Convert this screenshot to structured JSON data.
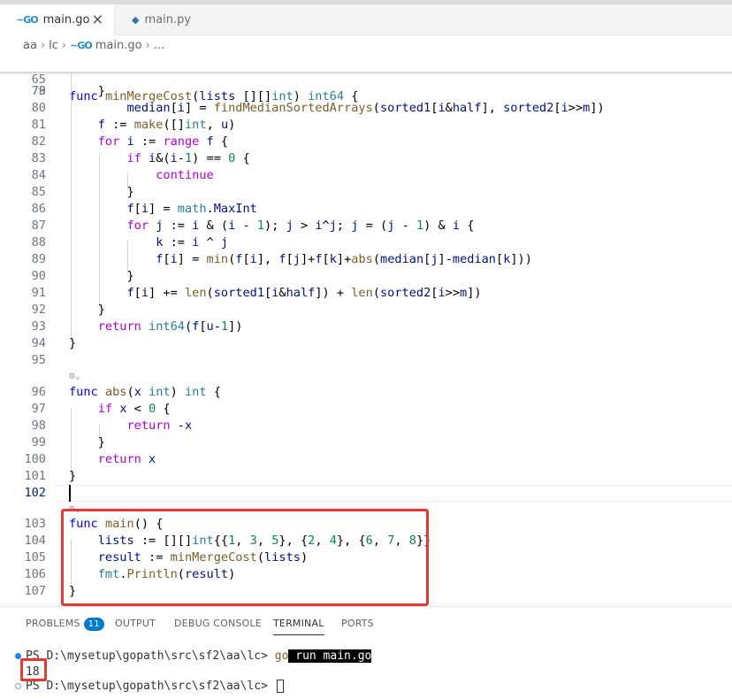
{
  "tabs": [
    {
      "icon": "go-file-icon",
      "label": "main.go",
      "active": true,
      "close": "×"
    },
    {
      "icon": "python-file-icon",
      "label": "main.py",
      "active": false
    }
  ],
  "breadcrumb": [
    "aa",
    "lc",
    "main.go",
    "..."
  ],
  "editor": {
    "sticky_line": {
      "num": "65",
      "text": "func minMergeCost(lists [][]int) int64 {"
    },
    "partial_line": {
      "num": "78",
      "text": "        median[i] = findMedianSortedArrays(sorted1[i&half], sorted2[i>>m])"
    },
    "lines": [
      {
        "num": "79",
        "text": "    }"
      },
      {
        "num": "80",
        "text": ""
      },
      {
        "num": "81",
        "text": "    f := make([]int, u)"
      },
      {
        "num": "82",
        "text": "    for i := range f {"
      },
      {
        "num": "83",
        "text": "        if i&(i-1) == 0 {"
      },
      {
        "num": "84",
        "text": "            continue"
      },
      {
        "num": "85",
        "text": "        }"
      },
      {
        "num": "86",
        "text": "        f[i] = math.MaxInt"
      },
      {
        "num": "87",
        "text": "        for j := i & (i - 1); j > i^j; j = (j - 1) & i {"
      },
      {
        "num": "88",
        "text": "            k := i ^ j"
      },
      {
        "num": "89",
        "text": "            f[i] = min(f[i], f[j]+f[k]+abs(median[j]-median[k]))"
      },
      {
        "num": "90",
        "text": "        }"
      },
      {
        "num": "91",
        "text": "        f[i] += len(sorted1[i&half]) + len(sorted2[i>>m])"
      },
      {
        "num": "92",
        "text": "    }"
      },
      {
        "num": "93",
        "text": "    return int64(f[u-1])"
      },
      {
        "num": "94",
        "text": "}"
      },
      {
        "num": "95",
        "text": ""
      },
      {
        "num": "96",
        "text": "func abs(x int) int {"
      },
      {
        "num": "97",
        "text": "    if x < 0 {"
      },
      {
        "num": "98",
        "text": "        return -x"
      },
      {
        "num": "99",
        "text": "    }"
      },
      {
        "num": "100",
        "text": "    return x"
      },
      {
        "num": "101",
        "text": "}"
      },
      {
        "num": "102",
        "text": ""
      },
      {
        "num": "103",
        "text": "func main() {"
      },
      {
        "num": "104",
        "text": "    lists := [][]int{{1, 3, 5}, {2, 4}, {6, 7, 8}}"
      },
      {
        "num": "105",
        "text": "    result := minMergeCost(lists)"
      },
      {
        "num": "106",
        "text": "    fmt.Println(result)"
      },
      {
        "num": "107",
        "text": "}"
      }
    ],
    "codelens_icon": "settings-chevron-icon"
  },
  "panel": {
    "tabs": [
      {
        "label": "PROBLEMS",
        "badge": "11"
      },
      {
        "label": "OUTPUT"
      },
      {
        "label": "DEBUG CONSOLE"
      },
      {
        "label": "TERMINAL",
        "active": true
      },
      {
        "label": "PORTS"
      }
    ],
    "terminal": {
      "prompt1": "PS D:\\mysetup\\gopath\\src\\sf2\\aa\\lc> ",
      "cmd_go": "go",
      "cmd_rest": " run main.go",
      "output": "18",
      "prompt2": "PS D:\\mysetup\\gopath\\src\\sf2\\aa\\lc> "
    }
  },
  "colors": {
    "accent": "#007acc",
    "highlight_box": "#e53935"
  }
}
